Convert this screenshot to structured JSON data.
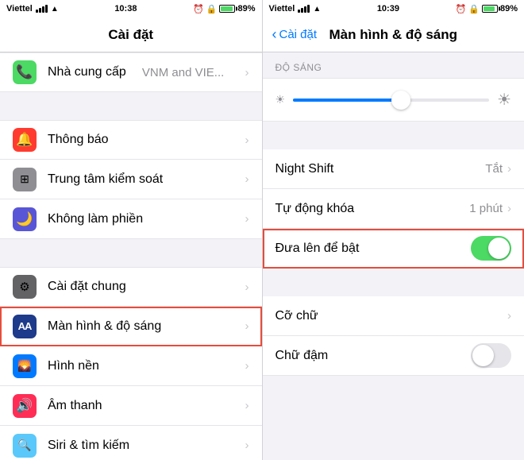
{
  "left": {
    "status": {
      "carrier": "Viettel",
      "time": "10:38",
      "battery_pct": "89%"
    },
    "title": "Cài đặt",
    "items_group1": [
      {
        "icon_class": "icon-green",
        "icon_char": "📞",
        "label": "Nhà cung cấp",
        "value": "VNM and VIE...",
        "has_chevron": true
      }
    ],
    "items_group2": [
      {
        "icon_class": "icon-red",
        "icon_char": "🔔",
        "label": "Thông báo",
        "value": "",
        "has_chevron": true
      },
      {
        "icon_class": "icon-gray",
        "icon_char": "🎛",
        "label": "Trung tâm kiểm soát",
        "value": "",
        "has_chevron": true
      },
      {
        "icon_class": "icon-purple",
        "icon_char": "🌙",
        "label": "Không làm phiền",
        "value": "",
        "has_chevron": true
      }
    ],
    "items_group3": [
      {
        "icon_class": "icon-dark-gray",
        "icon_char": "⚙️",
        "label": "Cài đặt chung",
        "value": "",
        "has_chevron": true,
        "selected": false
      },
      {
        "icon_class": "icon-aa",
        "icon_char": "AA",
        "label": "Màn hình & độ sáng",
        "value": "",
        "has_chevron": true,
        "selected": true
      },
      {
        "icon_class": "icon-blue",
        "icon_char": "🖼",
        "label": "Hình nền",
        "value": "",
        "has_chevron": true
      },
      {
        "icon_class": "icon-pink",
        "icon_char": "🔊",
        "label": "Âm thanh",
        "value": "",
        "has_chevron": true
      },
      {
        "icon_class": "icon-blue-gray",
        "icon_char": "🔍",
        "label": "Siri & tìm kiếm",
        "value": "",
        "has_chevron": true
      }
    ]
  },
  "right": {
    "status": {
      "carrier": "Viettel",
      "time": "10:39",
      "battery_pct": "89%"
    },
    "back_label": "Cài đặt",
    "title": "Màn hình & độ sáng",
    "brightness_section": "ĐỘ SÁNG",
    "slider_value": 55,
    "items": [
      {
        "label": "Night Shift",
        "value": "Tắt",
        "has_chevron": true,
        "has_toggle": false,
        "toggle_on": false,
        "highlighted": false
      },
      {
        "label": "Tự động khóa",
        "value": "1 phút",
        "has_chevron": true,
        "has_toggle": false,
        "toggle_on": false,
        "highlighted": false
      },
      {
        "label": "Đưa lên để bật",
        "value": "",
        "has_chevron": false,
        "has_toggle": true,
        "toggle_on": true,
        "highlighted": true
      }
    ],
    "items2": [
      {
        "label": "Cỡ chữ",
        "value": "",
        "has_chevron": true,
        "has_toggle": false
      },
      {
        "label": "Chữ đậm",
        "value": "",
        "has_chevron": false,
        "has_toggle": true,
        "toggle_on": false
      }
    ]
  }
}
